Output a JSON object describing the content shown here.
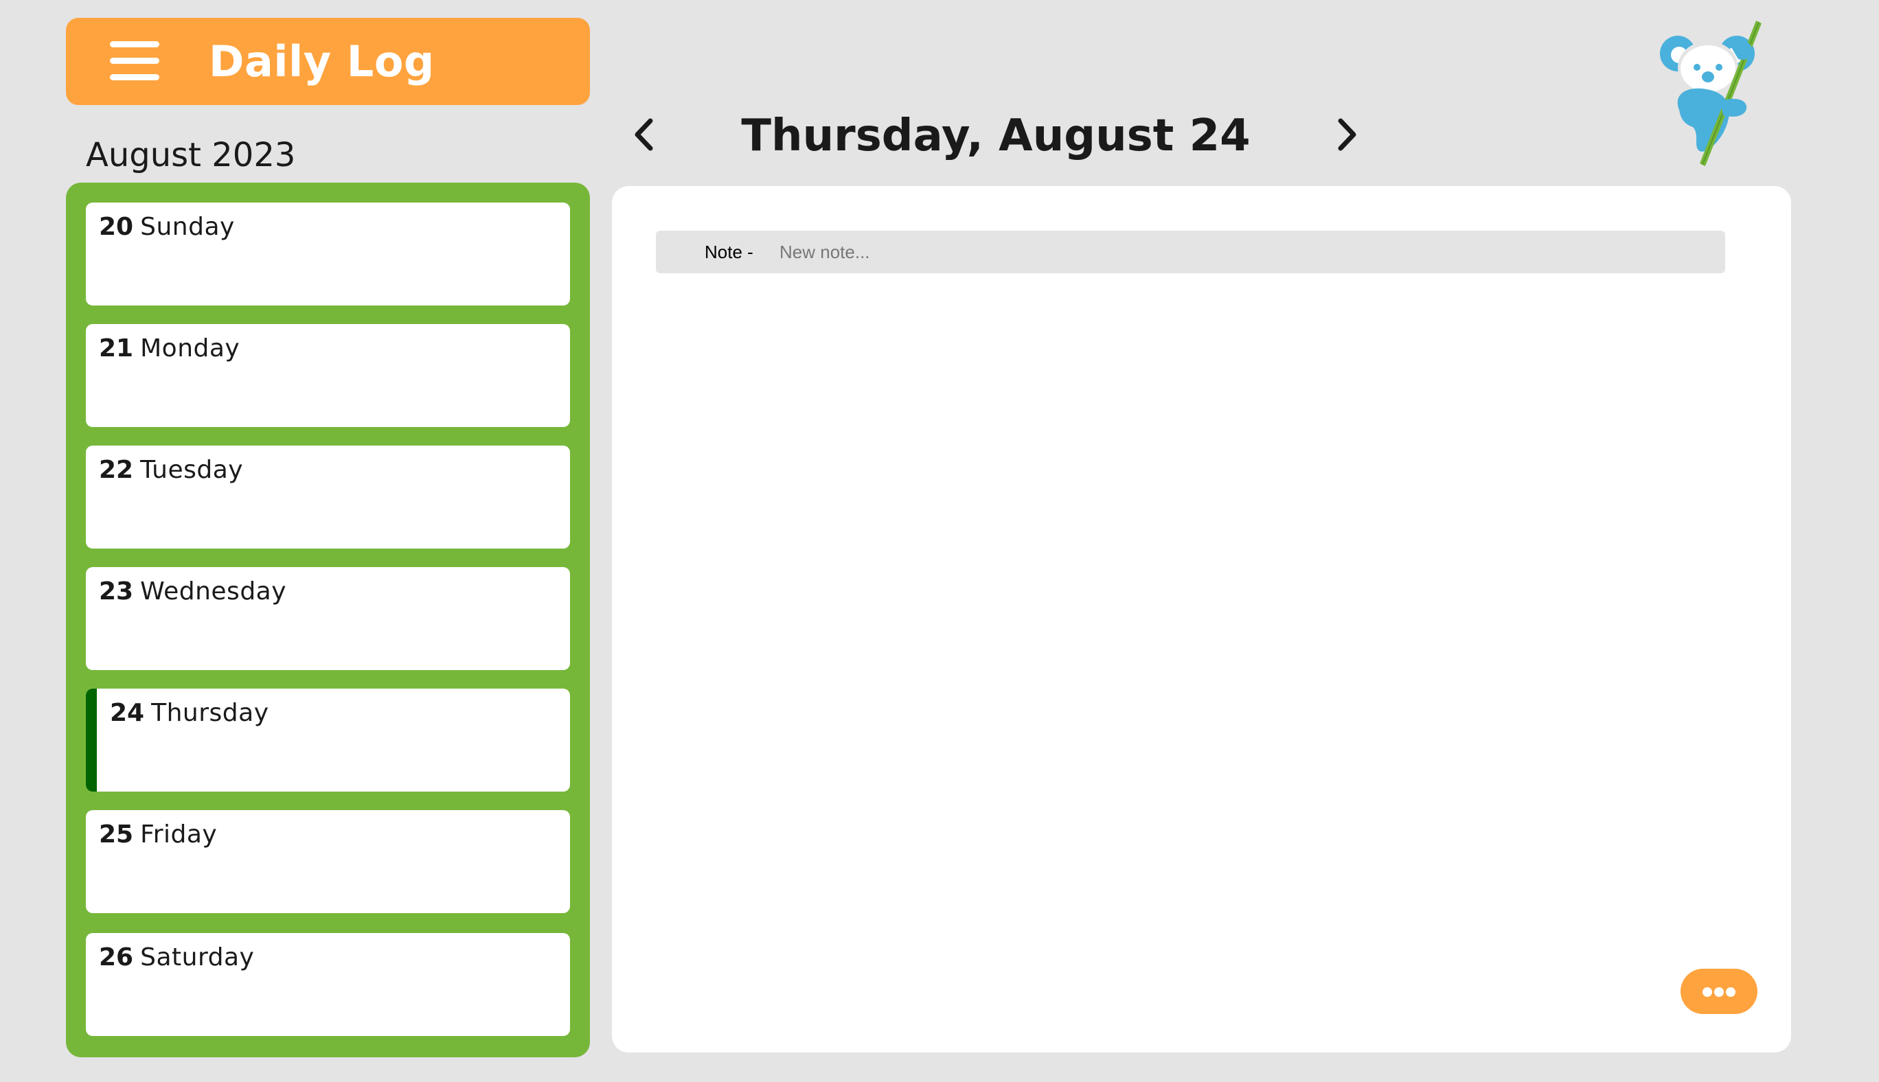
{
  "header": {
    "title": "Daily Log",
    "menu_icon": "hamburger-menu-icon"
  },
  "month": {
    "label": "August 2023"
  },
  "days": [
    {
      "num": "20",
      "name": "Sunday",
      "selected": false
    },
    {
      "num": "21",
      "name": "Monday",
      "selected": false
    },
    {
      "num": "22",
      "name": "Tuesday",
      "selected": false
    },
    {
      "num": "23",
      "name": "Wednesday",
      "selected": false
    },
    {
      "num": "24",
      "name": "Thursday",
      "selected": true
    },
    {
      "num": "25",
      "name": "Friday",
      "selected": false
    },
    {
      "num": "26",
      "name": "Saturday",
      "selected": false
    }
  ],
  "date_nav": {
    "title": "Thursday, August 24",
    "prev_icon": "chevron-left-icon",
    "next_icon": "chevron-right-icon"
  },
  "note": {
    "label": "Note -",
    "value": "",
    "placeholder": "New note..."
  },
  "more_button": {
    "icon": "more-dots-icon"
  },
  "logo": {
    "icon": "koala-logo-icon"
  },
  "colors": {
    "background": "#e4e4e4",
    "accent_orange": "#ffa33e",
    "list_green": "#76b73a",
    "selected_bar": "#006400",
    "logo_blue": "#4ab0dc",
    "logo_green": "#76b73a"
  }
}
